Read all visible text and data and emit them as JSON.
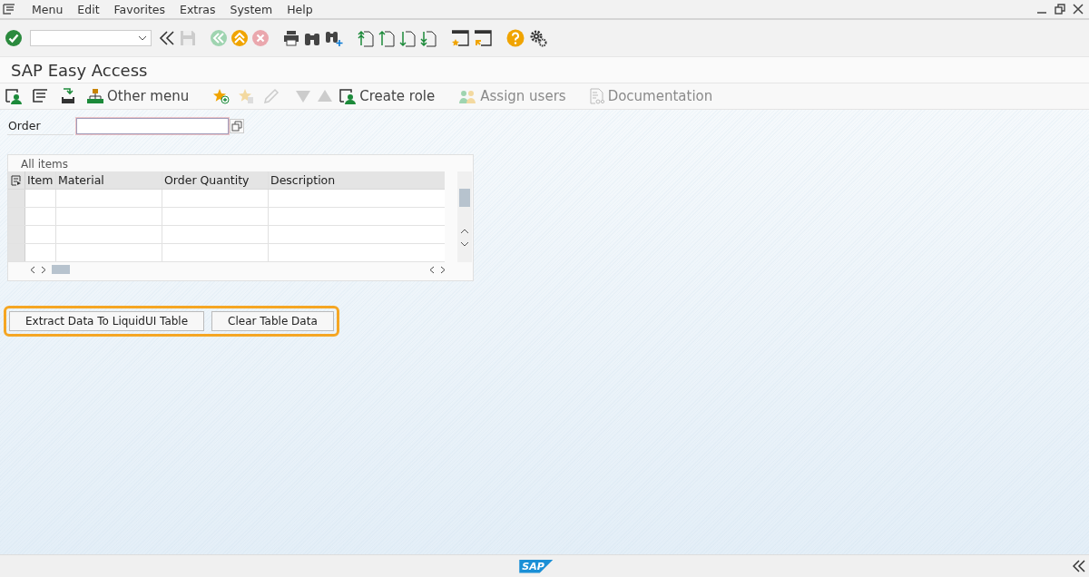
{
  "menu_bar": {
    "items": [
      "Menu",
      "Edit",
      "Favorites",
      "Extras",
      "System",
      "Help"
    ]
  },
  "title": "SAP Easy Access",
  "app_toolbar": [
    {
      "label": "Other menu",
      "disabled": false
    },
    {
      "label": "Create role",
      "disabled": false
    },
    {
      "label": "Assign users",
      "disabled": true
    },
    {
      "label": "Documentation",
      "disabled": true
    }
  ],
  "order_field": {
    "label": "Order"
  },
  "table": {
    "title": "All items",
    "columns": [
      "Item",
      "Material",
      "Order Quantity",
      "Description"
    ]
  },
  "buttons": [
    "Extract Data To LiquidUI Table",
    "Clear Table Data"
  ],
  "status_bar": {
    "logo": "SAP"
  }
}
